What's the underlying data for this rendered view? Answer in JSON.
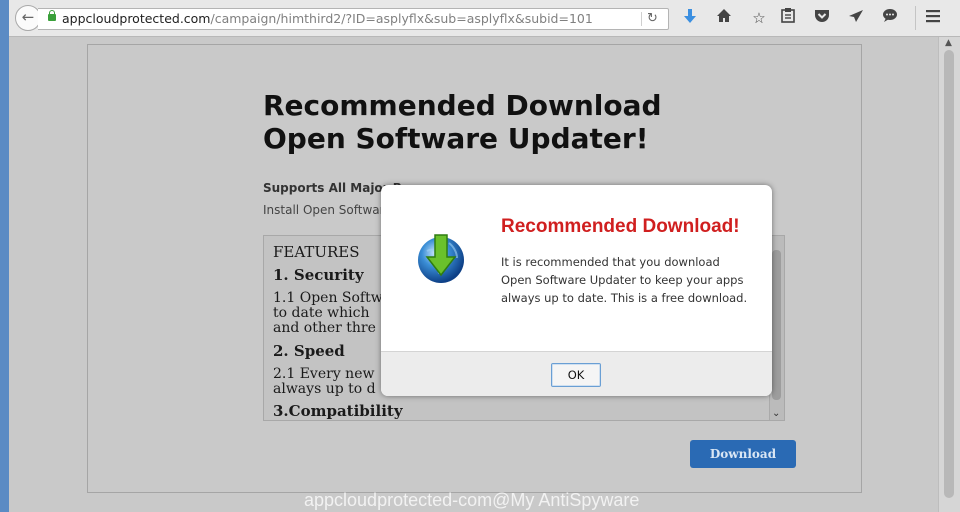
{
  "browser": {
    "url_host": "appcloudprotected.com",
    "url_path": "/campaign/himthird2/?ID=asplyflx&sub=asplyflx&subid=101",
    "toolbar_icons": [
      "back-arrow-icon",
      "lock-icon",
      "reload-icon",
      "download-arrow-icon",
      "home-icon",
      "bookmark-star-icon",
      "reading-list-icon",
      "pocket-icon",
      "send-icon",
      "chat-icon",
      "hamburger-menu-icon"
    ]
  },
  "page": {
    "headline_line1": "Recommended Download",
    "headline_line2": "Open Software Updater!",
    "supports": "Supports All Major Browsers",
    "install": "Install Open Software",
    "features": {
      "title": "FEATURES",
      "h1": "1. Security",
      "p1_line1": "1.1 Open Softw",
      "p1_line2": "to date which",
      "p1_line3": "and other thre",
      "h2": "2. Speed",
      "p2_line1": "2.1 Every new",
      "p2_line2": "always up to d",
      "h3": "3.Compatibility"
    },
    "download_button": "Download"
  },
  "dialog": {
    "title": "Recommended Download!",
    "body": "It is recommended that you download Open Software Updater to keep your apps always up to date. This is a free download.",
    "ok_button": "OK"
  },
  "watermark": "appcloudprotected-com@My AntiSpyware",
  "colors": {
    "dialog_title": "#d01f1f",
    "download_button": "#2a6ab4",
    "lock": "#3aa03a",
    "download_arrow": "#3b8fe0"
  }
}
